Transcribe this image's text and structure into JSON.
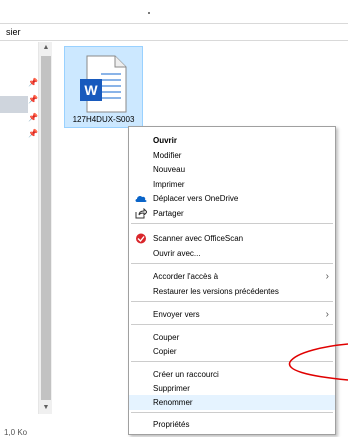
{
  "window": {
    "address_crumb": "sier"
  },
  "status_bar": {
    "text": "1,0 Ko"
  },
  "file": {
    "name": "127H4DUX-S003"
  },
  "context_menu": {
    "items": {
      "open": "Ouvrir",
      "edit": "Modifier",
      "new": "Nouveau",
      "print": "Imprimer",
      "move_onedrive": "Déplacer vers OneDrive",
      "share": "Partager",
      "scan": "Scanner avec OfficeScan",
      "open_with": "Ouvrir avec...",
      "grant_access": "Accorder l'accès à",
      "restore_versions": "Restaurer les versions précédentes",
      "send_to": "Envoyer vers",
      "cut": "Couper",
      "copy": "Copier",
      "create_shortcut": "Créer un raccourci",
      "delete": "Supprimer",
      "rename": "Renommer",
      "properties": "Propriétés"
    },
    "highlighted_item": "Renommer"
  },
  "icons": {
    "file": "word-document-icon",
    "onedrive": "onedrive-cloud-icon",
    "share": "share-icon",
    "scan": "officescan-icon",
    "pin": "pin-icon",
    "submenu": "chevron-right-icon"
  },
  "colors": {
    "selection_fill": "#cce8ff",
    "menu_highlight": "#e5f3ff",
    "word_blue": "#185abd",
    "annotation_red": "#e00000"
  }
}
